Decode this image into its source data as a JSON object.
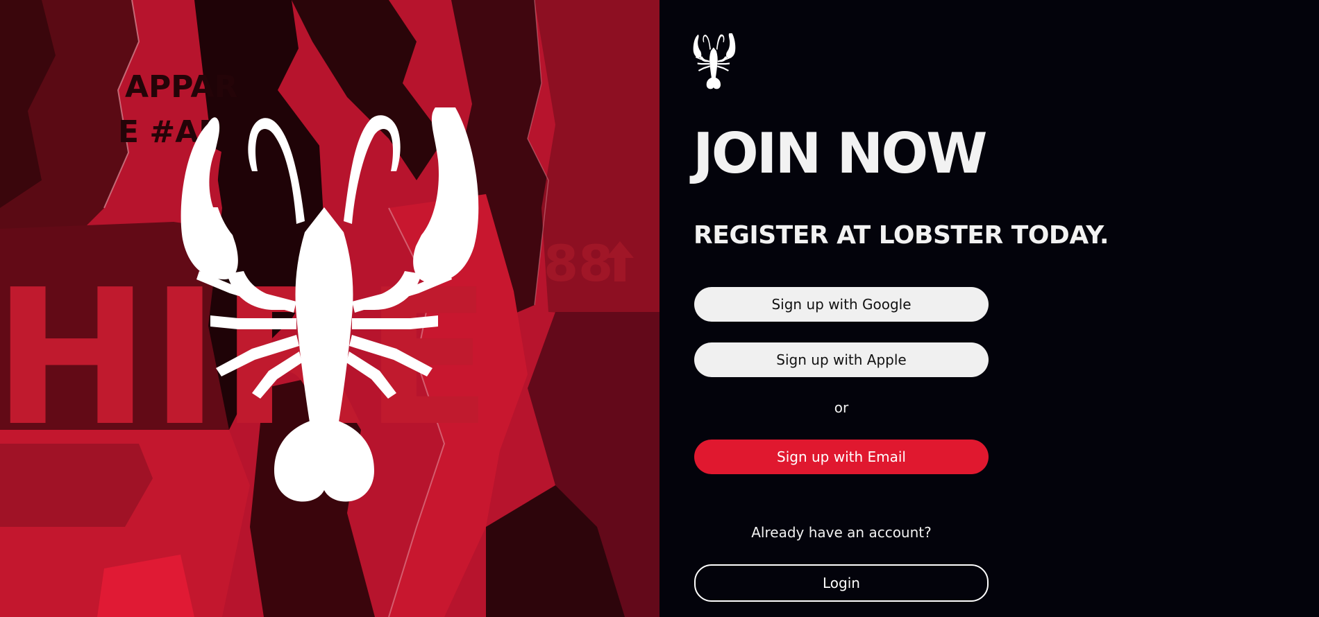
{
  "hero": {
    "poster_text_1": "APPAR",
    "poster_text_2": "E #AP",
    "poster_text_3": "HIRE",
    "poster_number": "88"
  },
  "signup": {
    "title": "JOIN NOW",
    "subtitle": "REGISTER AT LOBSTER TODAY.",
    "google_button": "Sign up with Google",
    "apple_button": "Sign up with Apple",
    "or_text": "or",
    "email_button": "Sign up with Email",
    "already_text": "Already have an account?",
    "login_button": "Login"
  },
  "icons": {
    "logo": "lobster-logo-icon",
    "hero": "lobster-hero-icon",
    "poster_arrow": "arrow-up-icon"
  },
  "colors": {
    "background": "#03030b",
    "accent_red": "#e0182f",
    "hero_red": "#b3142c",
    "button_light": "#f0f0f0",
    "text_light": "#f2f2f2"
  }
}
